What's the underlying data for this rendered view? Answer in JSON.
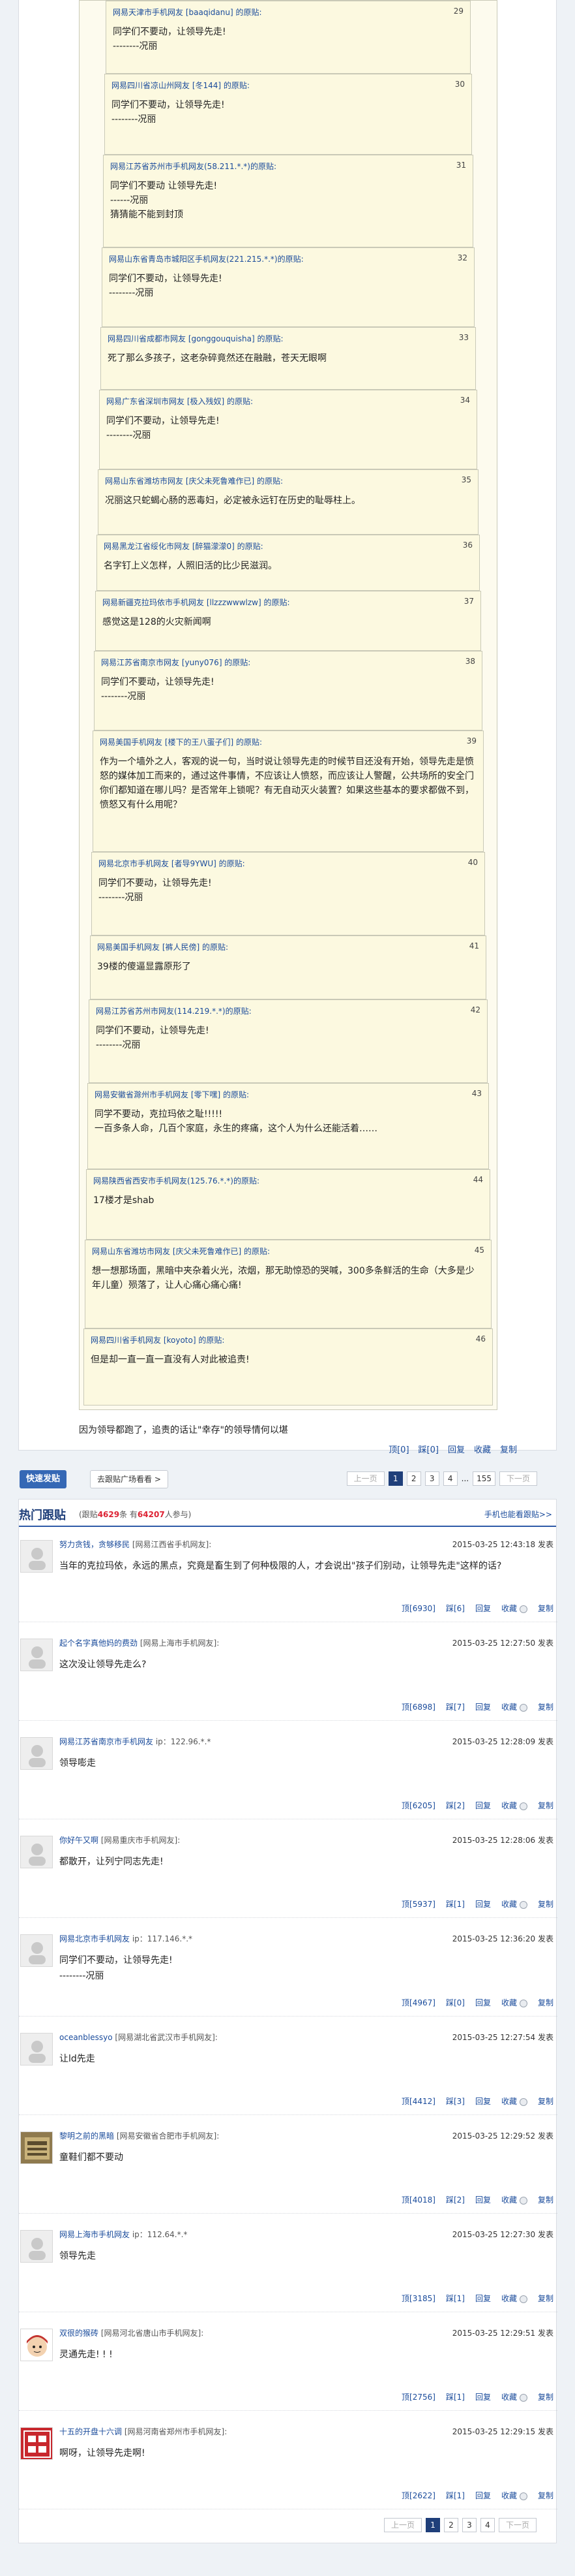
{
  "quotes": [
    {
      "head": "网易天津市手机网友 [baaqidanu] 的原贴:",
      "num": "29",
      "body": "同学们不要动，让领导先走!\n--------况丽"
    },
    {
      "head": "网易四川省凉山州网友 [冬144] 的原贴:",
      "num": "30",
      "body": "同学们不要动，让领导先走!\n--------况丽"
    },
    {
      "head": "网易江苏省苏州市手机网友(58.211.*.*)的原贴:",
      "num": "31",
      "body": "同学们不要动 让领导先走!\n------况丽\n猜猜能不能到封顶"
    },
    {
      "head": "网易山东省青岛市城阳区手机网友(221.215.*.*)的原贴:",
      "num": "32",
      "body": "同学们不要动，让领导先走!\n--------况丽"
    },
    {
      "head": "网易四川省成都市网友 [gonggouquisha] 的原贴:",
      "num": "33",
      "body": "死了那么多孩子，这老杂碎竟然还在融融，苍天无眼啊"
    },
    {
      "head": "网易广东省深圳市网友 [极入残奴] 的原贴:",
      "num": "34",
      "body": "同学们不要动，让领导先走!\n--------况丽"
    },
    {
      "head": "网易山东省潍坊市网友 [庆父未死鲁难作已] 的原贴:",
      "num": "35",
      "body": "况丽这只蛇蝎心肠的恶毒妇，必定被永远钉在历史的耻辱柱上。"
    },
    {
      "head": "网易黑龙江省绥化市网友 [醉猫濛濛0] 的原贴:",
      "num": "36",
      "body": "名字钉上义怎样，人照旧活的比少民滋润。"
    },
    {
      "head": "网易新疆克拉玛依市手机网友 [llzzzwwwlzw] 的原贴:",
      "num": "37",
      "body": "感觉这是128的火灾新闻啊"
    },
    {
      "head": "网易江苏省南京市网友 [yuny076] 的原贴:",
      "num": "38",
      "body": "同学们不要动，让领导先走!\n--------况丽"
    },
    {
      "head": "网易美国手机网友 [楼下的王八蛋子们] 的原贴:",
      "num": "39",
      "body": "作为一个墙外之人，客观的说一句，当时说让领导先走的时候节目还没有开始，领导先走是愤怒的媒体加工而来的，通过这件事情，不应该让人愤怒，而应该让人警醒，公共场所的安全门你们都知道在哪儿吗？是否常年上锁呢？有无自动灭火装置？如果这些基本的要求都做不到，愤怒又有什么用呢？"
    },
    {
      "head": "网易北京市手机网友 [者导9YWU] 的原贴:",
      "num": "40",
      "body": "同学们不要动，让领导先走!\n--------况丽"
    },
    {
      "head": "网易美国手机网友 [裤人民傍] 的原贴:",
      "num": "41",
      "body": "39楼的傻逼显露原形了"
    },
    {
      "head": "网易江苏省苏州市网友(114.219.*.*)的原贴:",
      "num": "42",
      "body": "同学们不要动，让领导先走!\n--------况丽"
    },
    {
      "head": "网易安徽省滁州市手机网友 [零下嘿] 的原贴:",
      "num": "43",
      "body": "同学不要动，克拉玛依之耻!!!!!\n一百多条人命，几百个家庭，永生的疼痛，这个人为什么还能活着……"
    },
    {
      "head": "网易陕西省西安市手机网友(125.76.*.*)的原贴:",
      "num": "44",
      "body": "17楼才是shab"
    },
    {
      "head": "网易山东省潍坊市网友 [庆父未死鲁难作已] 的原贴:",
      "num": "45",
      "body": "想一想那场面，黑暗中夹杂着火光，浓烟，那无助惊恐的哭喊，300多条鲜活的生命（大多是少年儿童）殒落了，让人心痛心痛心痛!"
    },
    {
      "head": "网易四川省手机网友 [koyoto] 的原贴:",
      "num": "46",
      "body": "但是却一直一直一直没有人对此被追责!"
    }
  ],
  "outer_text": "因为领导都跑了，追责的话让\"幸存\"的领导情何以堪",
  "card1_actions": [
    "顶[0]",
    "踩[0]",
    "回复",
    "收藏",
    "复制"
  ],
  "toolbar": {
    "quick_reply": "快速发贴",
    "plaza": "去跟贴广场看看 >"
  },
  "pager": {
    "prev": "上一页",
    "pages": [
      "1",
      "2",
      "3",
      "4",
      "...",
      "155"
    ],
    "next": "下一页"
  },
  "hot": {
    "title": "热门跟贴",
    "stats_prefix": "(跟贴",
    "reply_count": "4629",
    "stats_mid": "条 有",
    "people_count": "64207",
    "stats_suffix": "人参与)",
    "more": "手机也能看跟贴>>"
  },
  "replies": [
    {
      "user": "努力贪钱，贪够移民",
      "loc": "[网易江西省手机网友]:",
      "time": "2015-03-25 12:43:18 发表",
      "text": "当年的克拉玛依，永远的黑点，究竟是畜生到了何种极限的人，才会说出\"孩子们别动，让领导先走\"这样的话?",
      "ding": "顶[6930]",
      "cai": "踩[6]",
      "avatar": "default"
    },
    {
      "user": "起个名字真他妈的费劲",
      "loc": "[网易上海市手机网友]:",
      "time": "2015-03-25 12:27:50 发表",
      "text": "这次没让领导先走么?",
      "ding": "顶[6898]",
      "cai": "踩[7]",
      "avatar": "default"
    },
    {
      "user": "网易江苏省南京市手机网友",
      "loc": "ip：122.96.*.*",
      "time": "2015-03-25 12:28:09 发表",
      "text": "领导嘭走",
      "ding": "顶[6205]",
      "cai": "踩[2]",
      "avatar": "default"
    },
    {
      "user": "你好午又啊",
      "loc": "[网易重庆市手机网友]:",
      "time": "2015-03-25 12:28:06 发表",
      "text": "都散开，让列宁同志先走!",
      "ding": "顶[5937]",
      "cai": "踩[1]",
      "avatar": "default"
    },
    {
      "user": "网易北京市手机网友",
      "loc": "ip：117.146.*.*",
      "time": "2015-03-25 12:36:20 发表",
      "text": "同学们不要动，让领导先走!\n--------况丽",
      "ding": "顶[4967]",
      "cai": "踩[0]",
      "avatar": "default"
    },
    {
      "user": "oceanblessyo",
      "loc": "[网易湖北省武汉市手机网友]:",
      "time": "2015-03-25 12:27:54 发表",
      "text": "让ld先走",
      "ding": "顶[4412]",
      "cai": "踩[3]",
      "avatar": "default"
    },
    {
      "user": "黎明之前的黑暗",
      "loc": "[网易安徽省合肥市手机网友]:",
      "time": "2015-03-25 12:29:52 发表",
      "text": "童鞋们都不要动",
      "ding": "顶[4018]",
      "cai": "踩[2]",
      "avatar": "picture"
    },
    {
      "user": "网易上海市手机网友",
      "loc": "ip：112.64.*.*",
      "time": "2015-03-25 12:27:30 发表",
      "text": "领导先走",
      "ding": "顶[3185]",
      "cai": "踩[1]",
      "avatar": "default"
    },
    {
      "user": "双很的猴砖",
      "loc": "[网易河北省唐山市手机网友]:",
      "time": "2015-03-25 12:29:51 发表",
      "text": "灵通先走! ! !",
      "ding": "顶[2756]",
      "cai": "踩[1]",
      "avatar": "cartoon"
    },
    {
      "user": "十五的开盘十六调",
      "loc": "[网易河南省郑州市手机网友]:",
      "time": "2015-03-25 12:29:15 发表",
      "text": "啊呀，让领导先走啊!",
      "ding": "顶[2622]",
      "cai": "踩[1]",
      "avatar": "stamp"
    }
  ],
  "action_labels": {
    "reply": "回复",
    "fav": "收藏",
    "copy": "复制"
  }
}
